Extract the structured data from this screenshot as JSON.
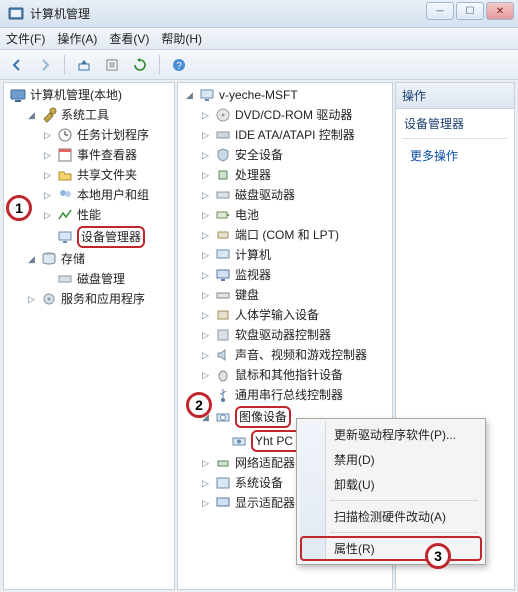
{
  "window": {
    "title": "计算机管理"
  },
  "menu": {
    "file": "文件(F)",
    "action": "操作(A)",
    "view": "查看(V)",
    "help": "帮助(H)"
  },
  "left_tree": {
    "root": "计算机管理(本地)",
    "system_tools": {
      "label": "系统工具",
      "children": {
        "task_scheduler": "任务计划程序",
        "event_viewer": "事件查看器",
        "shared_folders": "共享文件夹",
        "local_users": "本地用户和组",
        "performance": "性能",
        "device_manager": "设备管理器"
      }
    },
    "storage": {
      "label": "存储",
      "disk_mgmt": "磁盘管理"
    },
    "services_apps": "服务和应用程序"
  },
  "device_tree": {
    "root": "v-yeche-MSFT",
    "items": {
      "dvd": "DVD/CD-ROM 驱动器",
      "ide": "IDE ATA/ATAPI 控制器",
      "security": "安全设备",
      "processors": "处理器",
      "disk_drives": "磁盘驱动器",
      "batteries": "电池",
      "ports": "端口 (COM 和 LPT)",
      "computer": "计算机",
      "monitors": "监视器",
      "keyboards": "键盘",
      "hid": "人体学输入设备",
      "floppy_ctrl": "软盘驱动器控制器",
      "sound": "声音、视频和游戏控制器",
      "mice": "鼠标和其他指针设备",
      "usb": "通用串行总线控制器",
      "imaging": "图像设备",
      "imaging_child": "Yht PC Camera",
      "network": "网络适配器",
      "system_dev": "系统设备",
      "display": "显示适配器"
    }
  },
  "actions_pane": {
    "header": "操作",
    "section": "设备管理器",
    "more": "更多操作"
  },
  "context_menu": {
    "update": "更新驱动程序软件(P)...",
    "disable": "禁用(D)",
    "uninstall": "卸载(U)",
    "scan": "扫描检测硬件改动(A)",
    "props": "属性(R)"
  },
  "annotations": {
    "a1": "1",
    "a2": "2",
    "a3": "3"
  }
}
